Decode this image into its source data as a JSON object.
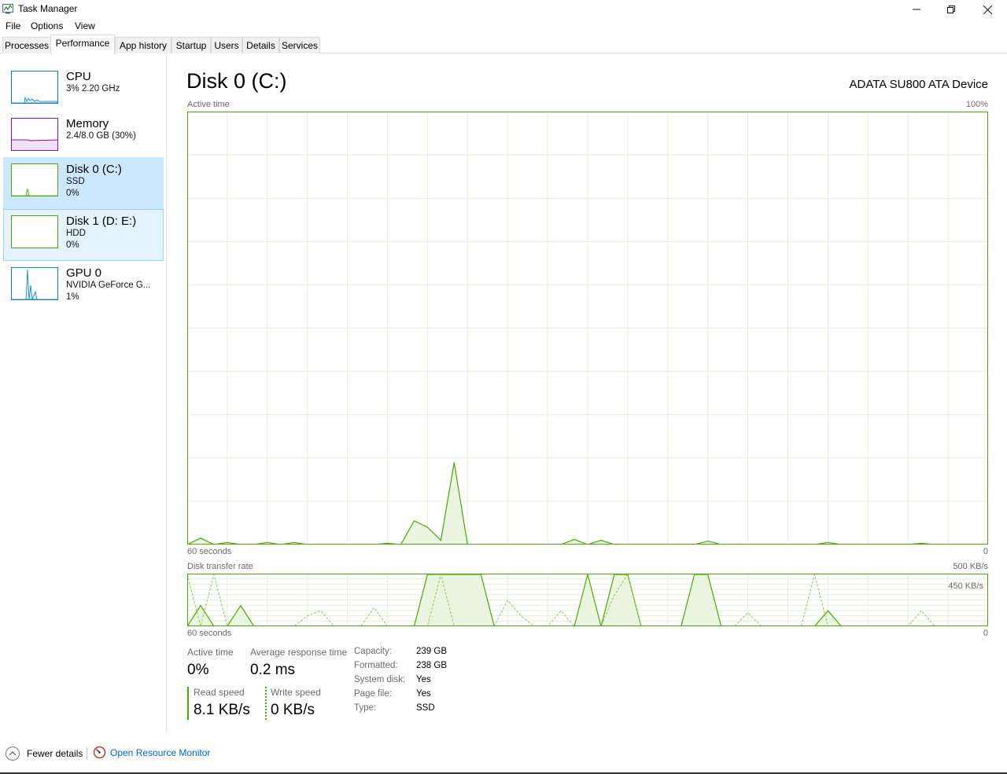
{
  "window": {
    "title": "Task Manager"
  },
  "menu": [
    "File",
    "Options",
    "View"
  ],
  "tabs": [
    "Processes",
    "Performance",
    "App history",
    "Startup",
    "Users",
    "Details",
    "Services"
  ],
  "sidebar": {
    "items": [
      {
        "name": "CPU",
        "line1": "3%  2.20 GHz",
        "line2": "",
        "color": "#117dbb"
      },
      {
        "name": "Memory",
        "line1": "2.4/8.0 GB (30%)",
        "line2": "",
        "color": "#8b12ae"
      },
      {
        "name": "Disk 0 (C:)",
        "line1": "SSD",
        "line2": "0%",
        "color": "#4da60c"
      },
      {
        "name": "Disk 1 (D: E:)",
        "line1": "HDD",
        "line2": "0%",
        "color": "#4da60c"
      },
      {
        "name": "GPU 0",
        "line1": "NVIDIA GeForce G...",
        "line2": "1%",
        "color": "#117dbb"
      }
    ]
  },
  "main": {
    "title": "Disk 0 (C:)",
    "device": "ADATA SU800 ATA Device",
    "active_chart": {
      "label": "Active time",
      "max_label": "100%",
      "time_label": "60 seconds",
      "min_label": "0"
    },
    "transfer_chart": {
      "label": "Disk transfer rate",
      "max_label": "500 KB/s",
      "mid_label": "450 KB/s",
      "time_label": "60 seconds",
      "min_label": "0"
    }
  },
  "stats": {
    "active_time_label": "Active time",
    "active_time_value": "0%",
    "avg_resp_label": "Average response time",
    "avg_resp_value": "0.2 ms",
    "read_label": "Read speed",
    "read_value": "8.1 KB/s",
    "write_label": "Write speed",
    "write_value": "0 KB/s"
  },
  "properties": [
    {
      "label": "Capacity:",
      "value": "239 GB"
    },
    {
      "label": "Formatted:",
      "value": "238 GB"
    },
    {
      "label": "System disk:",
      "value": "Yes"
    },
    {
      "label": "Page file:",
      "value": "Yes"
    },
    {
      "label": "Type:",
      "value": "SSD"
    }
  ],
  "footer": {
    "fewer": "Fewer details",
    "resource_monitor": "Open Resource Monitor"
  },
  "colors": {
    "disk_line": "#4da60c",
    "disk_fill": "#e9f5de",
    "grid": "#e6efd9",
    "link": "#0066cc"
  },
  "chart_data": [
    {
      "type": "area",
      "title": "Active time",
      "xlabel": "60 seconds",
      "ylabel": "",
      "xlim": [
        60,
        0
      ],
      "ylim": [
        0,
        100
      ],
      "x": [
        60,
        59,
        58,
        57,
        56,
        55,
        54,
        53,
        52,
        51,
        50,
        49,
        48,
        47,
        46,
        45,
        44,
        43,
        42,
        41,
        40,
        39,
        38,
        37,
        36,
        35,
        34,
        33,
        32,
        31,
        30,
        29,
        28,
        27,
        26,
        25,
        24,
        23,
        22,
        21,
        20,
        19,
        18,
        17,
        16,
        15,
        14,
        13,
        12,
        11,
        10,
        9,
        8,
        7,
        6,
        5,
        4,
        3,
        2,
        1,
        0
      ],
      "series": [
        {
          "values": [
            0,
            1.5,
            0,
            0.5,
            0,
            0,
            0.5,
            0,
            0.5,
            0,
            0,
            0,
            0,
            0,
            0,
            0.3,
            0,
            5.5,
            4,
            1,
            19,
            0,
            0,
            0,
            0,
            0,
            0,
            0,
            0,
            1.2,
            0,
            1,
            0,
            0,
            0,
            0,
            0,
            0,
            0,
            0.8,
            0,
            0,
            0,
            0,
            0,
            0,
            0,
            0,
            0.5,
            0,
            0,
            0,
            0,
            0,
            0,
            0.3,
            0,
            0,
            0,
            0,
            0
          ]
        }
      ]
    },
    {
      "type": "line",
      "title": "Disk transfer rate",
      "xlabel": "60 seconds",
      "ylabel": "",
      "xlim": [
        60,
        0
      ],
      "ylim": [
        0,
        500
      ],
      "x": [
        60,
        59,
        58,
        57,
        56,
        55,
        54,
        53,
        52,
        51,
        50,
        49,
        48,
        47,
        46,
        45,
        44,
        43,
        42,
        41,
        40,
        39,
        38,
        37,
        36,
        35,
        34,
        33,
        32,
        31,
        30,
        29,
        28,
        27,
        26,
        25,
        24,
        23,
        22,
        21,
        20,
        19,
        18,
        17,
        16,
        15,
        14,
        13,
        12,
        11,
        10,
        9,
        8,
        7,
        6,
        5,
        4,
        3,
        2,
        1,
        0
      ],
      "series": [
        {
          "name": "Read speed",
          "values": [
            0,
            200,
            0,
            0,
            200,
            0,
            0,
            0,
            0,
            0,
            0,
            0,
            0,
            0,
            0,
            0,
            0,
            0,
            500,
            500,
            500,
            500,
            500,
            0,
            0,
            0,
            0,
            0,
            0,
            0,
            500,
            0,
            500,
            500,
            0,
            0,
            0,
            0,
            500,
            500,
            0,
            0,
            0,
            0,
            0,
            0,
            0,
            0,
            150,
            0,
            0,
            0,
            0,
            0,
            0,
            0,
            0,
            0,
            0,
            0,
            0
          ]
        },
        {
          "name": "Write speed",
          "values": [
            500,
            0,
            500,
            0,
            0,
            0,
            0,
            0,
            0,
            100,
            150,
            0,
            0,
            0,
            180,
            0,
            0,
            0,
            0,
            500,
            0,
            0,
            0,
            0,
            250,
            100,
            0,
            0,
            150,
            0,
            0,
            0,
            300,
            500,
            0,
            0,
            0,
            0,
            0,
            0,
            0,
            0,
            130,
            0,
            0,
            0,
            0,
            500,
            0,
            0,
            0,
            0,
            0,
            0,
            0,
            150,
            0,
            0,
            0,
            0,
            0
          ]
        }
      ]
    }
  ]
}
